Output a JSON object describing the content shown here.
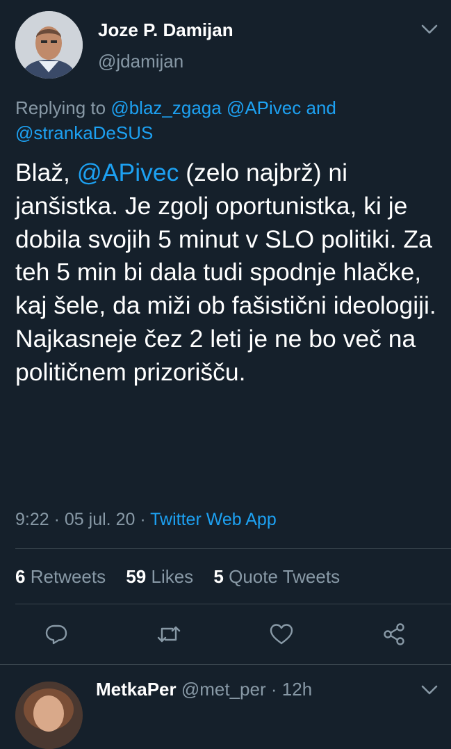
{
  "tweet": {
    "author_name": "Joze P. Damijan",
    "author_handle": "@jdamijan",
    "replying_prefix": "Replying to ",
    "replying_mentions": [
      "@blaz_zgaga",
      "@APivec"
    ],
    "replying_and": "and",
    "replying_last": "@strankaDeSUS",
    "text_before": "Blaž, ",
    "text_mention": "@APivec",
    "text_after": " (zelo najbrž) ni janšistka. Je zgolj oportunistka, ki je dobila svojih 5 minut v SLO politiki. Za teh 5 min bi dala tudi spodnje hlačke, kaj šele, da miži ob fašistični ideologiji. Najkasneje čez 2 leti je ne bo več na političnem prizorišču.",
    "time": "9:22",
    "separator": "·",
    "date": "05 jul. 20",
    "source": "Twitter Web App"
  },
  "stats": {
    "retweets_count": "6",
    "retweets_label": "Retweets",
    "likes_count": "59",
    "likes_label": "Likes",
    "quotes_count": "5",
    "quotes_label": "Quote Tweets"
  },
  "actions": [
    {
      "icon": "reply-icon"
    },
    {
      "icon": "retweet-icon"
    },
    {
      "icon": "like-icon"
    },
    {
      "icon": "share-icon"
    }
  ],
  "next_reply": {
    "author_name": "MetkaPer",
    "author_handle": "@met_per",
    "separator": "·",
    "time_ago": "12h"
  },
  "colors": {
    "background": "#15202b",
    "link": "#1da1f2",
    "muted": "#8899a6",
    "divider": "#38444d"
  }
}
